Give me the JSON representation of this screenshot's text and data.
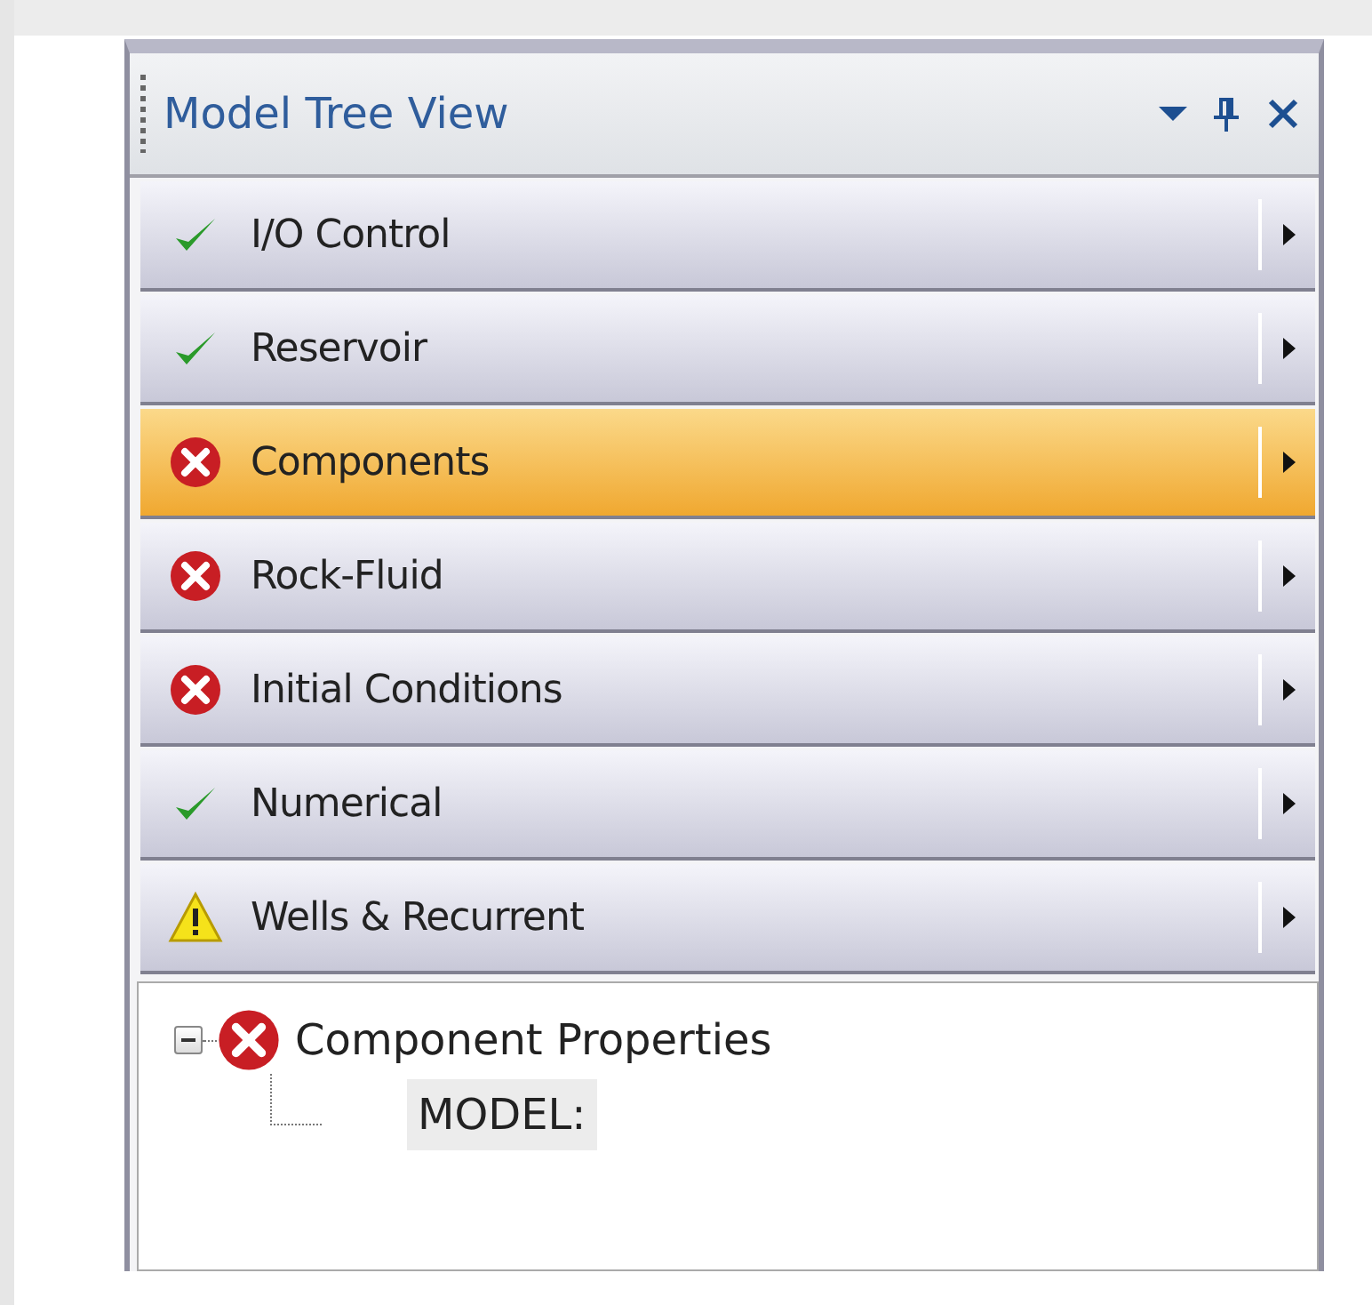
{
  "panel": {
    "title": "Model Tree View"
  },
  "sections": [
    {
      "label": "I/O Control",
      "kind": "ok",
      "selected": false
    },
    {
      "label": "Reservoir",
      "kind": "ok",
      "selected": false
    },
    {
      "label": "Components",
      "kind": "error",
      "selected": true
    },
    {
      "label": "Rock-Fluid",
      "kind": "error",
      "selected": false
    },
    {
      "label": "Initial Conditions",
      "kind": "error",
      "selected": false
    },
    {
      "label": "Numerical",
      "kind": "ok",
      "selected": false
    },
    {
      "label": "Wells & Recurrent",
      "kind": "warning",
      "selected": false
    }
  ],
  "tree": [
    {
      "label": "Component Properties",
      "kind": "error",
      "expanded": true,
      "children": [
        {
          "label": "MODEL:",
          "selected": true
        }
      ]
    }
  ]
}
